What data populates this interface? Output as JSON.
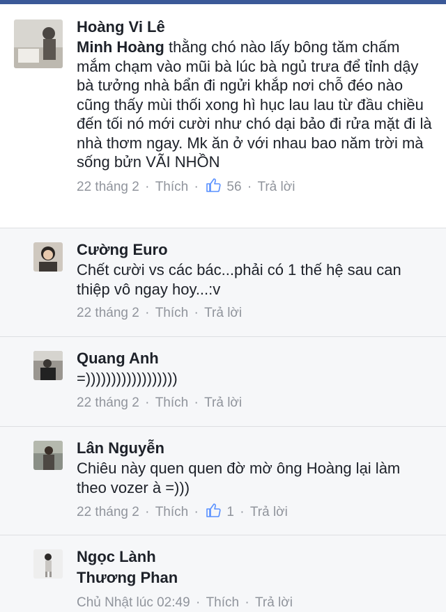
{
  "comments": [
    {
      "author": "Hoàng Vi Lê",
      "mention": "Minh Hoàng",
      "text": " thằng chó nào lấy bông tăm chấm mắm chạm vào mũi bà lúc bà ngủ trưa để tỉnh dậy bà tưởng nhà bẩn đi ngửi khắp nơi chỗ đéo nào cũng thấy mùi thối xong hì hục lau lau từ đầu chiều đến tối nó mới cười như chó dại bảo đi rửa mặt đi là nhà thơm ngay. Mk ăn ở với nhau bao năm trời mà sống bửn VÃI NHỒN",
      "time": "22 tháng 2",
      "like": "Thích",
      "reactions": "56",
      "reply": "Trả lời",
      "avatar_icon": "avatar-photo-icon"
    },
    {
      "author": "Cường Euro",
      "text": "Chết cười vs các bác...phải có 1 thế hệ sau can thiệp vô ngay hoy...:v",
      "time": "22 tháng 2",
      "like": "Thích",
      "reply": "Trả lời",
      "avatar_icon": "avatar-photo-icon"
    },
    {
      "author": "Quang Anh",
      "text": "=))))))))))))))))))",
      "time": "22 tháng 2",
      "like": "Thích",
      "reply": "Trả lời",
      "avatar_icon": "avatar-photo-icon"
    },
    {
      "author": "Lân Nguyễn",
      "text": "Chiêu này quen quen đờ mờ ông Hoàng lại làm theo vozer à =)))",
      "time": "22 tháng 2",
      "like": "Thích",
      "reactions": "1",
      "reply": "Trả lời",
      "avatar_icon": "avatar-photo-icon"
    },
    {
      "author": "Ngọc Lành",
      "mention": "Thương Phan",
      "time": "Chủ Nhật lúc 02:49",
      "like": "Thích",
      "reply": "Trả lời",
      "avatar_icon": "avatar-photo-icon"
    }
  ],
  "separator": "·",
  "colors": {
    "brand": "#3b5998",
    "meta": "#90949c",
    "like_icon": "#5890ff"
  }
}
